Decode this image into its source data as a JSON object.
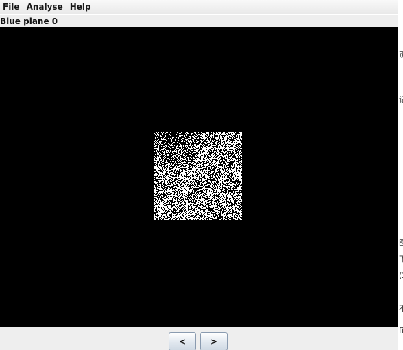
{
  "menu": {
    "items": [
      {
        "label": "File"
      },
      {
        "label": "Analyse"
      },
      {
        "label": "Help"
      }
    ]
  },
  "panel": {
    "title": "Blue plane 0"
  },
  "navigation": {
    "prev_label": "<",
    "next_label": ">"
  },
  "background_window": {
    "fragments": [
      "页",
      "记",
      "图",
      "下",
      "(2",
      "不",
      "fi"
    ]
  },
  "colors": {
    "image_background": "#000000",
    "window_background": "#eeeeee",
    "noise_foreground": "#ffffff"
  }
}
